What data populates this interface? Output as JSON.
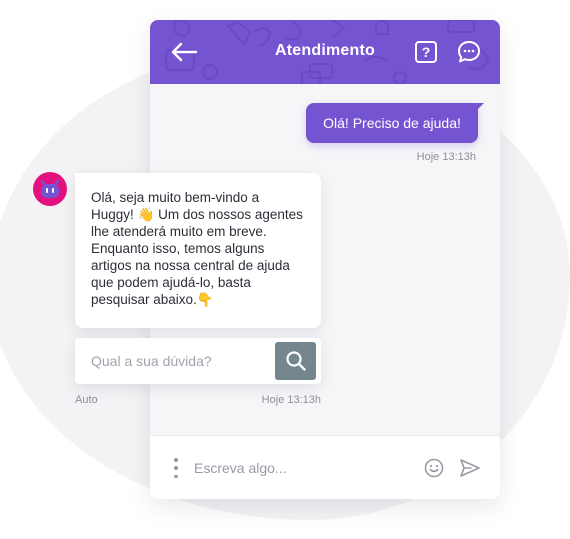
{
  "header": {
    "title": "Atendimento",
    "help_icon": "?",
    "back_icon": "arrow-left-icon",
    "chat_icon": "chat-bubble-icon"
  },
  "messages": {
    "sent": {
      "text": "Olá! Preciso de ajuda!",
      "time": "Hoje 13:13h"
    },
    "received": {
      "text": "Olá, seja muito bem-vindo a Huggy! 👋 Um dos nossos agentes lhe atenderá muito em breve. Enquanto isso, temos alguns artigos na nossa central de ajuda que podem ajudá-lo, basta pesquisar abaixo.👇",
      "time": "Hoje 13:13h",
      "sender_label": "Auto"
    }
  },
  "search": {
    "placeholder": "Qual a sua dúvida?"
  },
  "composer": {
    "placeholder": "Escreva algo..."
  },
  "colors": {
    "brand": "#7554d2",
    "avatar": "#e3117f",
    "search_button": "#74868e"
  }
}
